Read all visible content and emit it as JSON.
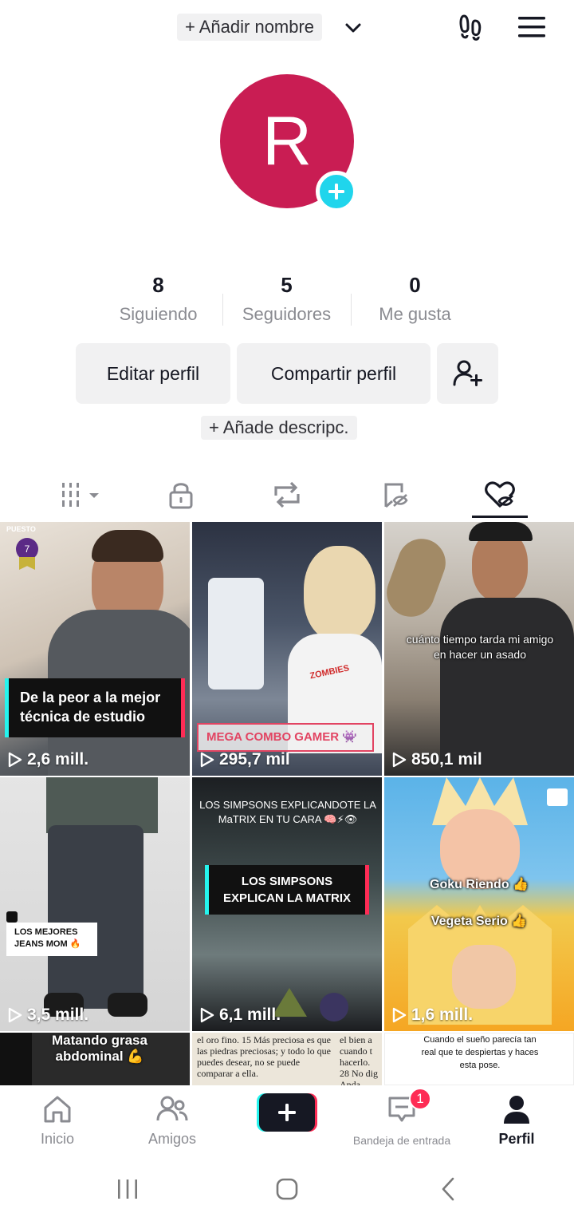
{
  "header": {
    "name_button": "+ Añadir nombre"
  },
  "avatar": {
    "initial": "R",
    "color": "#c91d53",
    "add_color": "#20d5ec"
  },
  "stats": [
    {
      "value": "8",
      "label": "Siguiendo"
    },
    {
      "value": "5",
      "label": "Seguidores"
    },
    {
      "value": "0",
      "label": "Me gusta"
    }
  ],
  "actions": {
    "edit": "Editar perfil",
    "share": "Compartir perfil"
  },
  "description_button": "+ Añade descripc.",
  "tabs": [
    "videos-grid-icon",
    "private-lock-icon",
    "reposts-icon",
    "favorites-icon",
    "liked-icon"
  ],
  "videos": [
    {
      "views": "2,6 mill.",
      "rank_label": "PUESTO",
      "rank": "7",
      "caption": "De la peor a la mejor técnica de estudio"
    },
    {
      "views": "295,7 mil",
      "caption": "MEGA COMBO GAMER 👾"
    },
    {
      "views": "850,1 mil",
      "caption": "cuánto tiempo tarda mi amigo en hacer un asado"
    },
    {
      "views": "3,5 mill.",
      "caption": "LOS MEJORES JEANS MOM 🔥"
    },
    {
      "views": "6,1 mill.",
      "top_caption": "LOS SIMPSONS EXPLICANDOTE LA MaTRIX EN TU CARA 🧠⚡👁",
      "caption": "LOS SIMPSONS EXPLICAN LA MATRIX"
    },
    {
      "views": "1,6 mill.",
      "caption_top": "Goku Riendo 👍",
      "caption_bottom": "Vegeta Serio 👍"
    },
    {
      "caption": "Matando grasa abdominal 💪"
    },
    {
      "text_left": "el oro fino. 15 Más preciosa es que las piedras preciosas; y todo lo que puedes desear, no se puede comparar a ella.",
      "text_right": "el bien a cuando t hacerlo. 28 No dig Anda"
    },
    {
      "caption": "Cuando el sueño parecía tan real que te despiertas y haces esta pose."
    }
  ],
  "bottom_nav": {
    "home": "Inicio",
    "friends": "Amigos",
    "inbox": "Bandeja de entrada",
    "inbox_badge": "1",
    "profile": "Perfil"
  },
  "colors": {
    "accent_pink": "#fe2c55",
    "accent_cyan": "#25f4ee",
    "text_gray": "#8a8b91"
  }
}
